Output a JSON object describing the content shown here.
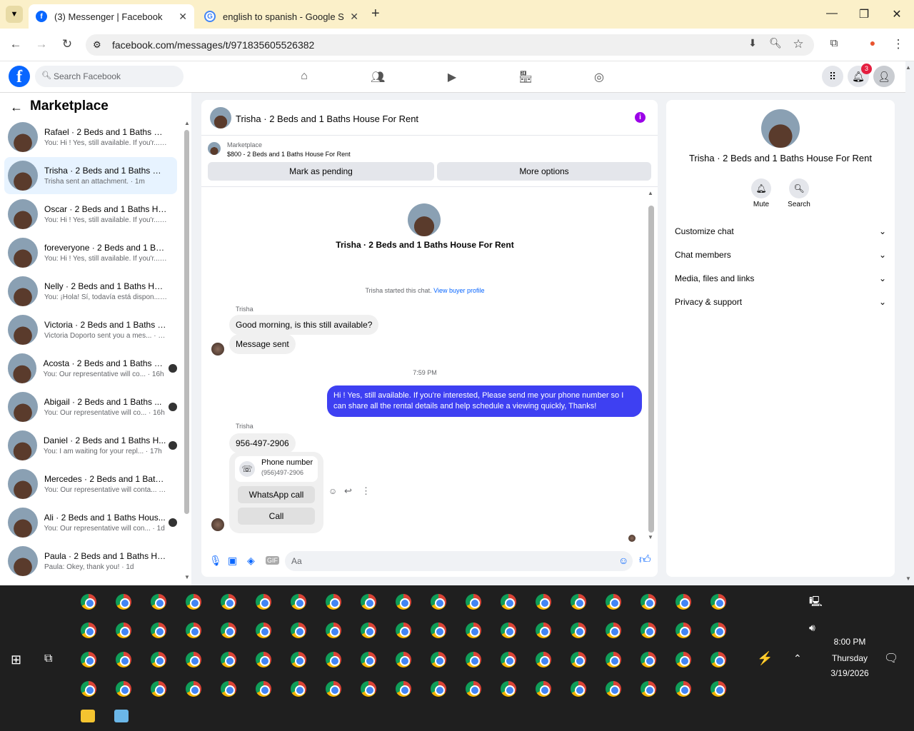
{
  "browser": {
    "tabs": [
      {
        "title": "(3) Messenger | Facebook"
      },
      {
        "title": "english to spanish - Google Sea"
      }
    ],
    "url": "facebook.com/messages/t/971835605526382"
  },
  "facebook": {
    "search_placeholder": "Search Facebook",
    "notification_count": "3"
  },
  "left_panel": {
    "title": "Marketplace",
    "conversations": [
      {
        "name": "Rafael · 2 Beds and 1 Baths Hou...",
        "preview": "You: Hi ! Yes, still available. If you'r... · 1m"
      },
      {
        "name": "Trisha · 2 Beds and 1 Baths Hou...",
        "preview": "Trisha sent an attachment. · 1m"
      },
      {
        "name": "Oscar · 2 Beds and 1 Baths Hou...",
        "preview": "You: Hi ! Yes, still available. If you'r... · 1m"
      },
      {
        "name": "foreveryone · 2 Beds and 1 Bath...",
        "preview": "You: Hi ! Yes, still available. If you'r... · 1m"
      },
      {
        "name": "Nelly · 2 Beds and 1 Baths Hous...",
        "preview": "You: ¡Hola! Sí, todavía está dispon... · 1m"
      },
      {
        "name": "Victoria · 2 Beds and 1 Baths Ho...",
        "preview": "Victoria Doporto sent you a mes... · 59m"
      },
      {
        "name": "Acosta · 2 Beds and 1 Baths H...",
        "preview": "You: Our representative will co... · 16h"
      },
      {
        "name": "Abigail · 2 Beds and 1 Baths ...",
        "preview": "You: Our representative will co... · 16h"
      },
      {
        "name": "Daniel · 2 Beds and 1 Baths H...",
        "preview": "You: I am waiting for your repl... · 17h"
      },
      {
        "name": "Mercedes · 2 Beds and 1 Baths ...",
        "preview": "You: Our representative will conta... · 1d"
      },
      {
        "name": "Ali · 2 Beds and 1 Baths Hous...",
        "preview": "You: Our representative will con... · 1d"
      },
      {
        "name": "Paula · 2 Beds and 1 Baths Hous...",
        "preview": "Paula: Okey, thank you! · 1d"
      }
    ]
  },
  "chat": {
    "title": "Trisha · 2 Beds and 1 Baths House For Rent",
    "listing_label": "Marketplace",
    "listing_detail": "$800 - 2 Beds and 1 Baths House For Rent",
    "mark_pending": "Mark as pending",
    "more_options": "More options",
    "header_name": "Trisha · 2 Beds and 1 Baths House For Rent",
    "started_text": "Trisha started this chat.",
    "view_profile": "View buyer profile",
    "sender1": "Trisha",
    "msg1": "Good morning, is this still available?",
    "msg2": "Message sent",
    "timestamp": "7:59 PM",
    "msg_out": "Hi ! Yes, still available. If you're interested, Please send me your phone number so I can share all the rental details and help schedule a viewing quickly, Thanks!",
    "sender2": "Trisha",
    "msg3": "956-497-2906",
    "phone_card_title": "Phone number",
    "phone_card_number": "(956)497-2906",
    "whatsapp_call": "WhatsApp call",
    "call": "Call",
    "composer_placeholder": "Aa"
  },
  "right_panel": {
    "name": "Trisha · 2 Beds and 1 Baths House For Rent",
    "mute": "Mute",
    "search": "Search",
    "sections": [
      "Customize chat",
      "Chat members",
      "Media, files and links",
      "Privacy & support"
    ]
  },
  "taskbar": {
    "time": "8:00 PM",
    "day": "Thursday",
    "date": "3/19/2026"
  }
}
